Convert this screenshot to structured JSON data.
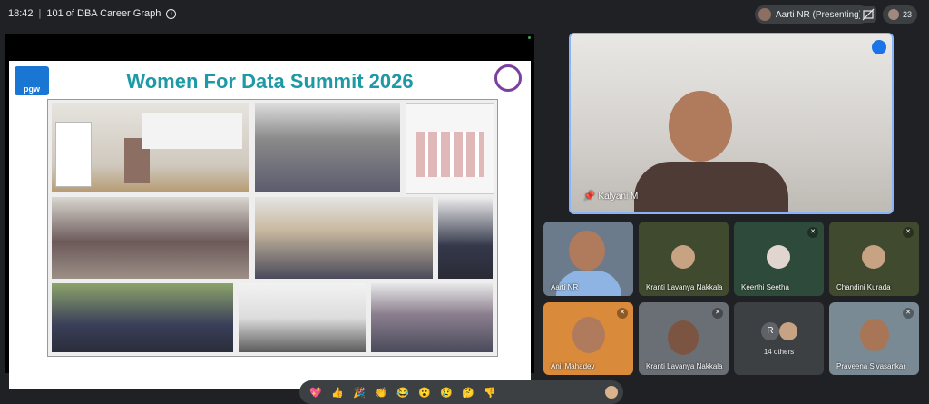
{
  "meeting": {
    "time": "18:42",
    "separator": "|",
    "title": "101 of DBA Career Graph",
    "info_icon": "ⓘ"
  },
  "topbar": {
    "presenter_label": "Aarti NR (Presenting)",
    "people_count": "23"
  },
  "slide": {
    "title": "Women For Data Summit 2026",
    "logo_text": "pgw"
  },
  "speaker": {
    "name": "Kalyani M"
  },
  "participants": [
    {
      "name": "Aarti NR",
      "muted": false
    },
    {
      "name": "Kranti Lavanya Nakkala",
      "muted": false
    },
    {
      "name": "Keerthi Seetha",
      "muted": true
    },
    {
      "name": "Chandini Kurada",
      "muted": true
    },
    {
      "name": "Anil Mahadev",
      "muted": true
    },
    {
      "name": "Kranti Lavanya Nakkala",
      "muted": true
    },
    {
      "name": "14 others",
      "initial": "R"
    },
    {
      "name": "Praveena Sivasankar",
      "muted": true
    }
  ],
  "reactions": [
    "💖",
    "👍",
    "🎉",
    "👏",
    "😂",
    "😮",
    "😢",
    "🤔",
    "👎"
  ]
}
